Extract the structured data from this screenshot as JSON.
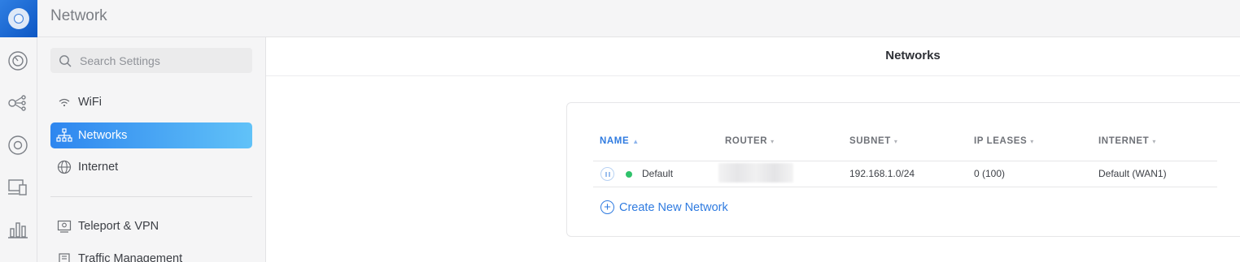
{
  "topbar": {
    "title": "Network"
  },
  "search": {
    "placeholder": "Search Settings"
  },
  "sidebar": {
    "items": [
      {
        "label": "WiFi",
        "icon": "wifi-icon"
      },
      {
        "label": "Networks",
        "icon": "networks-icon",
        "active": true
      },
      {
        "label": "Internet",
        "icon": "globe-icon"
      },
      {
        "label": "Teleport & VPN",
        "icon": "teleport-icon"
      },
      {
        "label": "Traffic Management",
        "icon": "traffic-icon"
      }
    ]
  },
  "rail": {
    "icons": [
      "dashboard-icon",
      "topology-icon",
      "devices-icon",
      "clients-icon",
      "statistics-icon"
    ]
  },
  "main": {
    "title": "Networks",
    "table": {
      "headers": [
        "NAME",
        "ROUTER",
        "SUBNET",
        "IP LEASES",
        "INTERNET"
      ],
      "rows": [
        {
          "name": "Default",
          "router": "",
          "subnet": "192.168.1.0/24",
          "ip_leases": "0 (100)",
          "internet": "Default (WAN1)",
          "status_color": "#2fc26b"
        }
      ]
    },
    "create_label": "Create New Network"
  },
  "colors": {
    "accent": "#2f7be0",
    "active_gradient_start": "#2e86ef",
    "active_gradient_end": "#61c2f8",
    "status_online": "#2fc26b"
  }
}
